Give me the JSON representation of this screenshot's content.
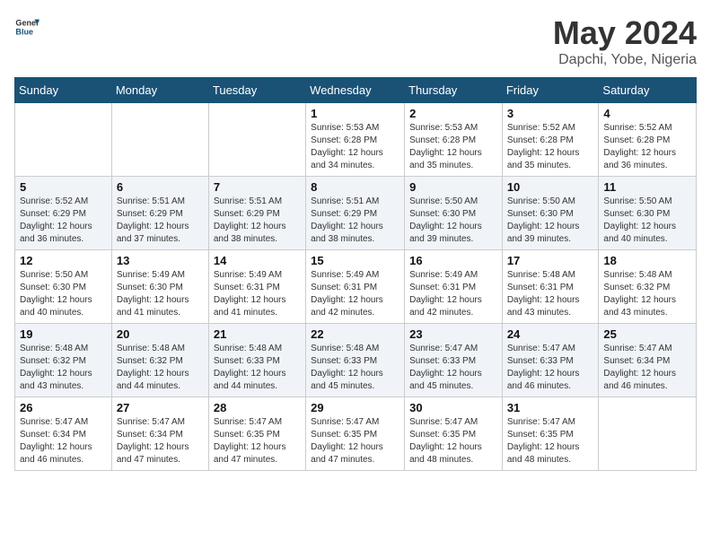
{
  "header": {
    "logo_general": "General",
    "logo_blue": "Blue",
    "title": "May 2024",
    "location": "Dapchi, Yobe, Nigeria"
  },
  "weekdays": [
    "Sunday",
    "Monday",
    "Tuesday",
    "Wednesday",
    "Thursday",
    "Friday",
    "Saturday"
  ],
  "weeks": [
    [
      {
        "day": "",
        "sunrise": "",
        "sunset": "",
        "daylight": ""
      },
      {
        "day": "",
        "sunrise": "",
        "sunset": "",
        "daylight": ""
      },
      {
        "day": "",
        "sunrise": "",
        "sunset": "",
        "daylight": ""
      },
      {
        "day": "1",
        "sunrise": "Sunrise: 5:53 AM",
        "sunset": "Sunset: 6:28 PM",
        "daylight": "Daylight: 12 hours and 34 minutes."
      },
      {
        "day": "2",
        "sunrise": "Sunrise: 5:53 AM",
        "sunset": "Sunset: 6:28 PM",
        "daylight": "Daylight: 12 hours and 35 minutes."
      },
      {
        "day": "3",
        "sunrise": "Sunrise: 5:52 AM",
        "sunset": "Sunset: 6:28 PM",
        "daylight": "Daylight: 12 hours and 35 minutes."
      },
      {
        "day": "4",
        "sunrise": "Sunrise: 5:52 AM",
        "sunset": "Sunset: 6:28 PM",
        "daylight": "Daylight: 12 hours and 36 minutes."
      }
    ],
    [
      {
        "day": "5",
        "sunrise": "Sunrise: 5:52 AM",
        "sunset": "Sunset: 6:29 PM",
        "daylight": "Daylight: 12 hours and 36 minutes."
      },
      {
        "day": "6",
        "sunrise": "Sunrise: 5:51 AM",
        "sunset": "Sunset: 6:29 PM",
        "daylight": "Daylight: 12 hours and 37 minutes."
      },
      {
        "day": "7",
        "sunrise": "Sunrise: 5:51 AM",
        "sunset": "Sunset: 6:29 PM",
        "daylight": "Daylight: 12 hours and 38 minutes."
      },
      {
        "day": "8",
        "sunrise": "Sunrise: 5:51 AM",
        "sunset": "Sunset: 6:29 PM",
        "daylight": "Daylight: 12 hours and 38 minutes."
      },
      {
        "day": "9",
        "sunrise": "Sunrise: 5:50 AM",
        "sunset": "Sunset: 6:30 PM",
        "daylight": "Daylight: 12 hours and 39 minutes."
      },
      {
        "day": "10",
        "sunrise": "Sunrise: 5:50 AM",
        "sunset": "Sunset: 6:30 PM",
        "daylight": "Daylight: 12 hours and 39 minutes."
      },
      {
        "day": "11",
        "sunrise": "Sunrise: 5:50 AM",
        "sunset": "Sunset: 6:30 PM",
        "daylight": "Daylight: 12 hours and 40 minutes."
      }
    ],
    [
      {
        "day": "12",
        "sunrise": "Sunrise: 5:50 AM",
        "sunset": "Sunset: 6:30 PM",
        "daylight": "Daylight: 12 hours and 40 minutes."
      },
      {
        "day": "13",
        "sunrise": "Sunrise: 5:49 AM",
        "sunset": "Sunset: 6:30 PM",
        "daylight": "Daylight: 12 hours and 41 minutes."
      },
      {
        "day": "14",
        "sunrise": "Sunrise: 5:49 AM",
        "sunset": "Sunset: 6:31 PM",
        "daylight": "Daylight: 12 hours and 41 minutes."
      },
      {
        "day": "15",
        "sunrise": "Sunrise: 5:49 AM",
        "sunset": "Sunset: 6:31 PM",
        "daylight": "Daylight: 12 hours and 42 minutes."
      },
      {
        "day": "16",
        "sunrise": "Sunrise: 5:49 AM",
        "sunset": "Sunset: 6:31 PM",
        "daylight": "Daylight: 12 hours and 42 minutes."
      },
      {
        "day": "17",
        "sunrise": "Sunrise: 5:48 AM",
        "sunset": "Sunset: 6:31 PM",
        "daylight": "Daylight: 12 hours and 43 minutes."
      },
      {
        "day": "18",
        "sunrise": "Sunrise: 5:48 AM",
        "sunset": "Sunset: 6:32 PM",
        "daylight": "Daylight: 12 hours and 43 minutes."
      }
    ],
    [
      {
        "day": "19",
        "sunrise": "Sunrise: 5:48 AM",
        "sunset": "Sunset: 6:32 PM",
        "daylight": "Daylight: 12 hours and 43 minutes."
      },
      {
        "day": "20",
        "sunrise": "Sunrise: 5:48 AM",
        "sunset": "Sunset: 6:32 PM",
        "daylight": "Daylight: 12 hours and 44 minutes."
      },
      {
        "day": "21",
        "sunrise": "Sunrise: 5:48 AM",
        "sunset": "Sunset: 6:33 PM",
        "daylight": "Daylight: 12 hours and 44 minutes."
      },
      {
        "day": "22",
        "sunrise": "Sunrise: 5:48 AM",
        "sunset": "Sunset: 6:33 PM",
        "daylight": "Daylight: 12 hours and 45 minutes."
      },
      {
        "day": "23",
        "sunrise": "Sunrise: 5:47 AM",
        "sunset": "Sunset: 6:33 PM",
        "daylight": "Daylight: 12 hours and 45 minutes."
      },
      {
        "day": "24",
        "sunrise": "Sunrise: 5:47 AM",
        "sunset": "Sunset: 6:33 PM",
        "daylight": "Daylight: 12 hours and 46 minutes."
      },
      {
        "day": "25",
        "sunrise": "Sunrise: 5:47 AM",
        "sunset": "Sunset: 6:34 PM",
        "daylight": "Daylight: 12 hours and 46 minutes."
      }
    ],
    [
      {
        "day": "26",
        "sunrise": "Sunrise: 5:47 AM",
        "sunset": "Sunset: 6:34 PM",
        "daylight": "Daylight: 12 hours and 46 minutes."
      },
      {
        "day": "27",
        "sunrise": "Sunrise: 5:47 AM",
        "sunset": "Sunset: 6:34 PM",
        "daylight": "Daylight: 12 hours and 47 minutes."
      },
      {
        "day": "28",
        "sunrise": "Sunrise: 5:47 AM",
        "sunset": "Sunset: 6:35 PM",
        "daylight": "Daylight: 12 hours and 47 minutes."
      },
      {
        "day": "29",
        "sunrise": "Sunrise: 5:47 AM",
        "sunset": "Sunset: 6:35 PM",
        "daylight": "Daylight: 12 hours and 47 minutes."
      },
      {
        "day": "30",
        "sunrise": "Sunrise: 5:47 AM",
        "sunset": "Sunset: 6:35 PM",
        "daylight": "Daylight: 12 hours and 48 minutes."
      },
      {
        "day": "31",
        "sunrise": "Sunrise: 5:47 AM",
        "sunset": "Sunset: 6:35 PM",
        "daylight": "Daylight: 12 hours and 48 minutes."
      },
      {
        "day": "",
        "sunrise": "",
        "sunset": "",
        "daylight": ""
      }
    ]
  ]
}
